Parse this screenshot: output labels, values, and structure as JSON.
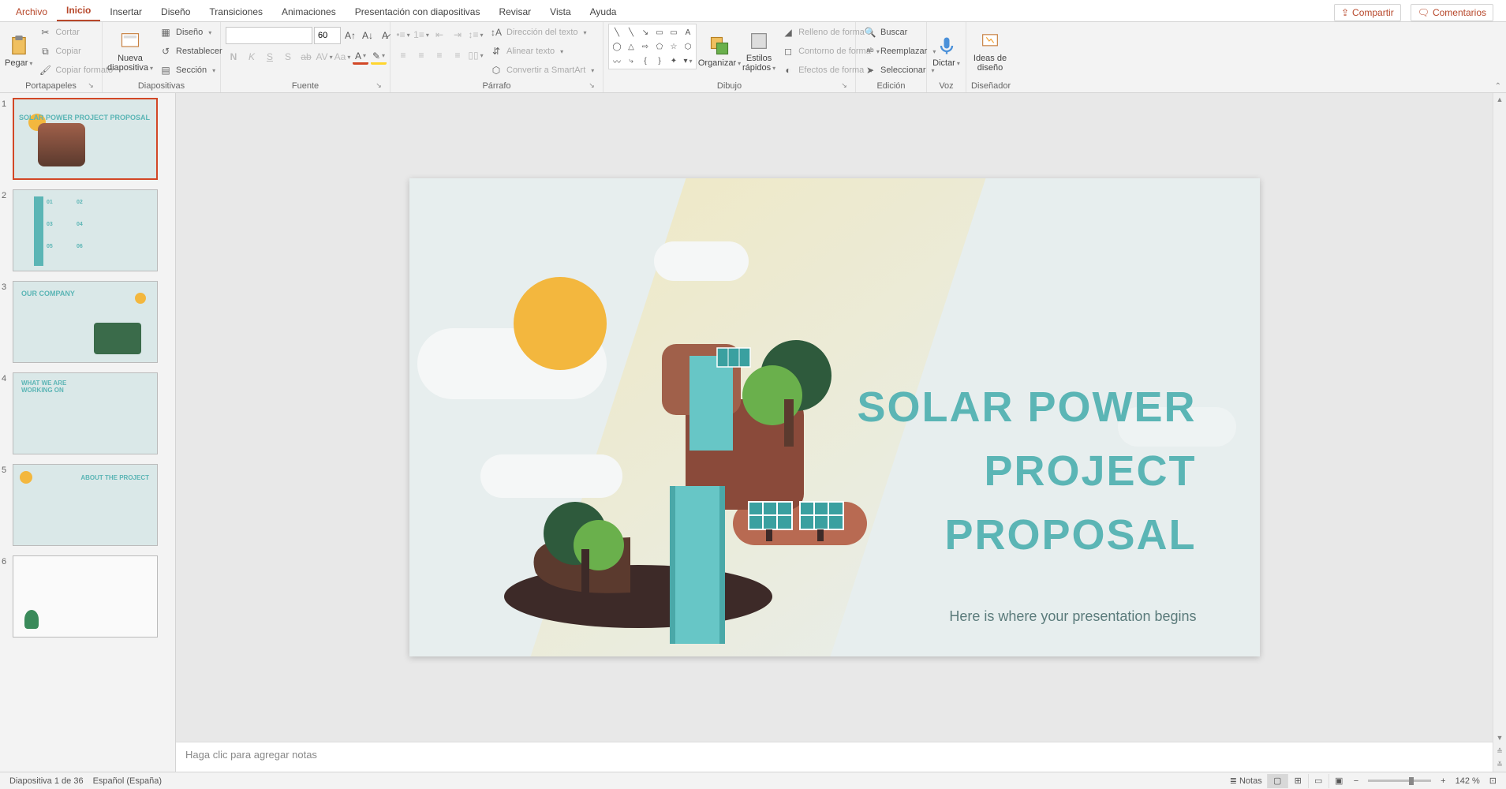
{
  "tabs": {
    "file": "Archivo",
    "home": "Inicio",
    "insert": "Insertar",
    "design": "Diseño",
    "transitions": "Transiciones",
    "animations": "Animaciones",
    "slideshow": "Presentación con diapositivas",
    "review": "Revisar",
    "view": "Vista",
    "help": "Ayuda"
  },
  "tab_right": {
    "share": "Compartir",
    "comments": "Comentarios"
  },
  "ribbon": {
    "clipboard": {
      "label": "Portapapeles",
      "paste": "Pegar",
      "cut": "Cortar",
      "copy": "Copiar",
      "format_painter": "Copiar formato"
    },
    "slides": {
      "label": "Diapositivas",
      "new_slide": "Nueva diapositiva",
      "layout": "Diseño",
      "reset": "Restablecer",
      "section": "Sección"
    },
    "font": {
      "label": "Fuente",
      "size": "60"
    },
    "paragraph": {
      "label": "Párrafo",
      "text_dir": "Dirección del texto",
      "align_text": "Alinear texto",
      "smartart": "Convertir a SmartArt"
    },
    "drawing": {
      "label": "Dibujo",
      "arrange": "Organizar",
      "quick_styles": "Estilos rápidos",
      "fill": "Relleno de forma",
      "outline": "Contorno de forma",
      "effects": "Efectos de forma"
    },
    "editing": {
      "label": "Edición",
      "find": "Buscar",
      "replace": "Reemplazar",
      "select": "Seleccionar"
    },
    "voice": {
      "label": "Voz",
      "dictate": "Dictar"
    },
    "designer": {
      "label": "Diseñador",
      "ideas": "Ideas de diseño"
    }
  },
  "thumbs": [
    {
      "n": "1",
      "title": "SOLAR POWER PROJECT PROPOSAL"
    },
    {
      "n": "2",
      "title": ""
    },
    {
      "n": "3",
      "title": "OUR COMPANY"
    },
    {
      "n": "4",
      "title": "WHAT WE ARE WORKING ON"
    },
    {
      "n": "5",
      "title": "ABOUT THE PROJECT"
    },
    {
      "n": "6",
      "title": ""
    }
  ],
  "slide": {
    "title_l1": "SOLAR POWER",
    "title_l2": "PROJECT",
    "title_l3": "PROPOSAL",
    "subtitle": "Here is where your presentation begins"
  },
  "notes_placeholder": "Haga clic para agregar notas",
  "status": {
    "slide_pos": "Diapositiva 1 de 36",
    "lang": "Español (España)",
    "notes_btn": "Notas",
    "zoom": "142 %"
  }
}
